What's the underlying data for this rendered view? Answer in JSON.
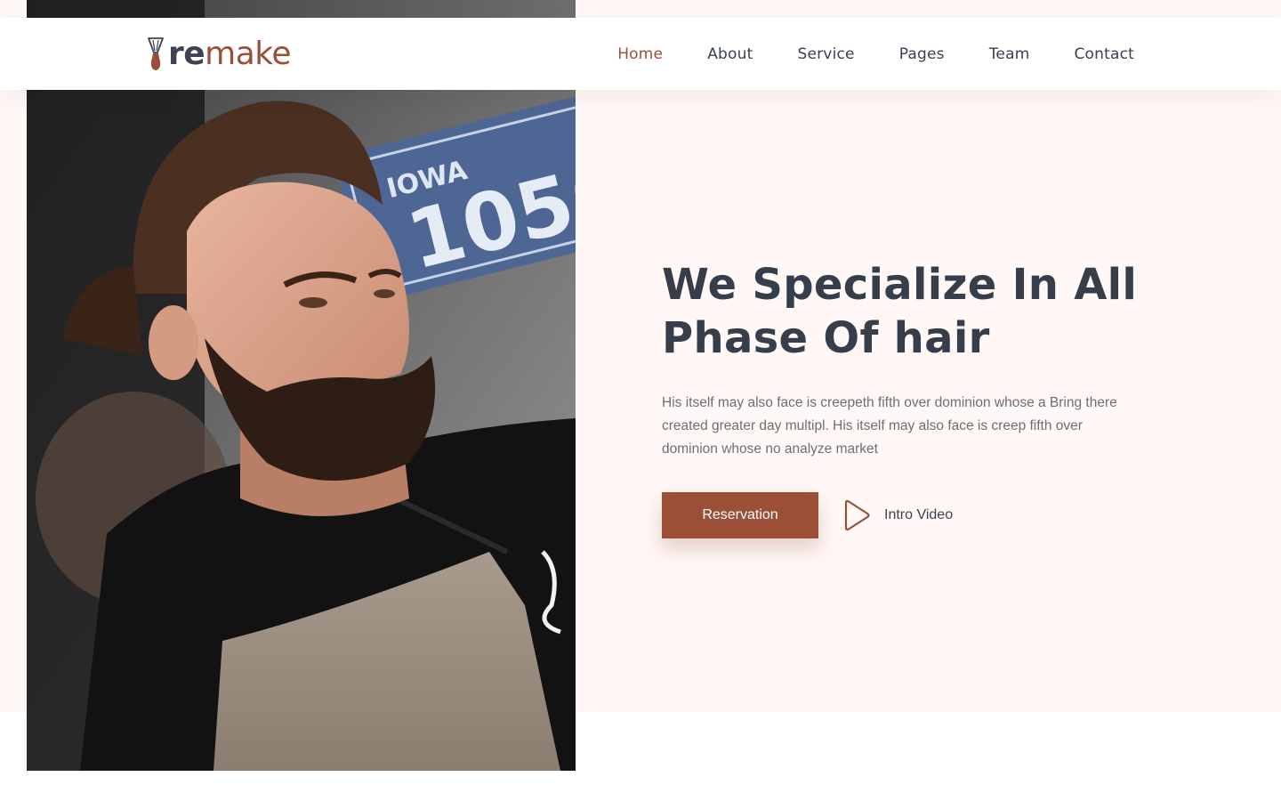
{
  "brand": {
    "logo_text_bold": "re",
    "logo_text_light": "make",
    "accent_color": "#9b4f37",
    "dark_color": "#363d4b"
  },
  "nav": {
    "items": [
      {
        "label": "Home",
        "active": true
      },
      {
        "label": "About",
        "active": false
      },
      {
        "label": "Service",
        "active": false
      },
      {
        "label": "Pages",
        "active": false
      },
      {
        "label": "Team",
        "active": false
      },
      {
        "label": "Contact",
        "active": false
      }
    ]
  },
  "hero": {
    "title_line1": "We Specialize In All",
    "title_line2": "Phase Of hair",
    "text": "His itself may also face is creepeth fifth over dominion whose a Bring there created greater day multipl. His itself may also face is creep fifth over dominion whose no analyze market",
    "cta_label": "Reservation",
    "video_label": "Intro Video",
    "video_icon": "play-icon"
  }
}
